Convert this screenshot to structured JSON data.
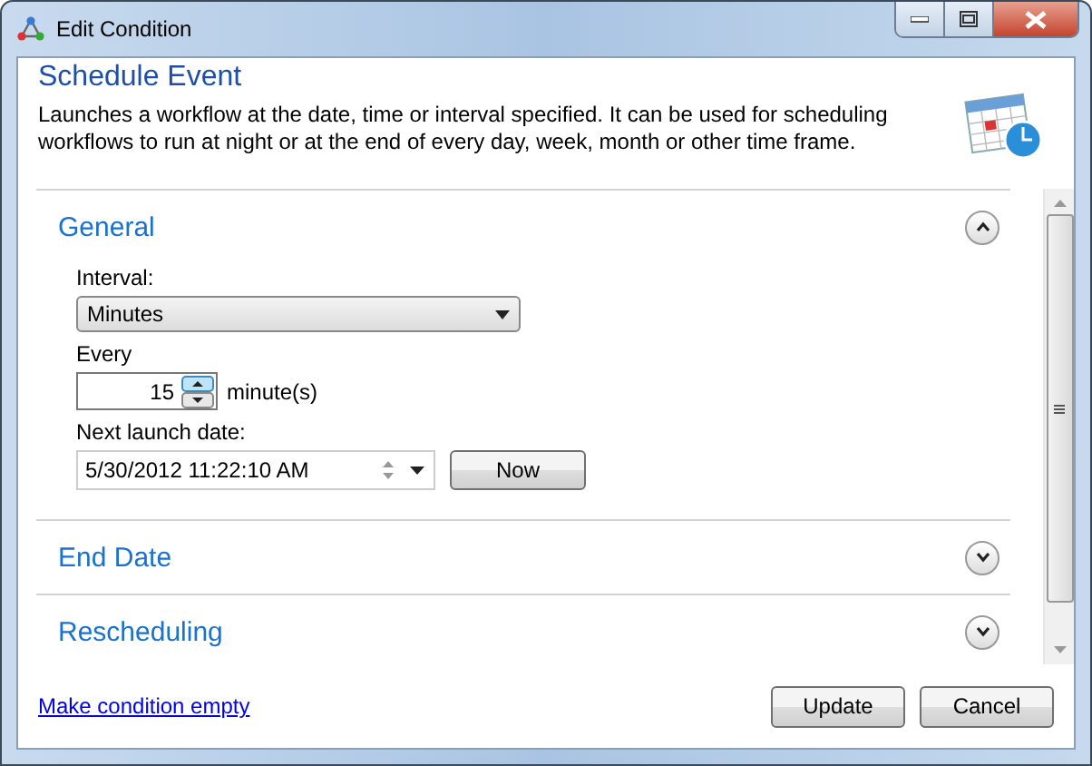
{
  "window": {
    "title": "Edit Condition"
  },
  "header": {
    "title": "Schedule Event",
    "description": "Launches a workflow at the date, time or interval specified. It can be used for scheduling workflows to run at night or at the end of every day, week, month or other time frame."
  },
  "sections": [
    {
      "title": "General",
      "expanded": true
    },
    {
      "title": "End Date",
      "expanded": false
    },
    {
      "title": "Rescheduling",
      "expanded": false
    }
  ],
  "general": {
    "interval_label": "Interval:",
    "interval_value": "Minutes",
    "every_label": "Every",
    "every_value": "15",
    "every_unit": "minute(s)",
    "next_label": "Next launch date:",
    "next_value": "5/30/2012 11:22:10 AM",
    "now_button": "Now"
  },
  "footer": {
    "link": "Make condition empty",
    "buttons": [
      "Update",
      "Cancel"
    ]
  }
}
